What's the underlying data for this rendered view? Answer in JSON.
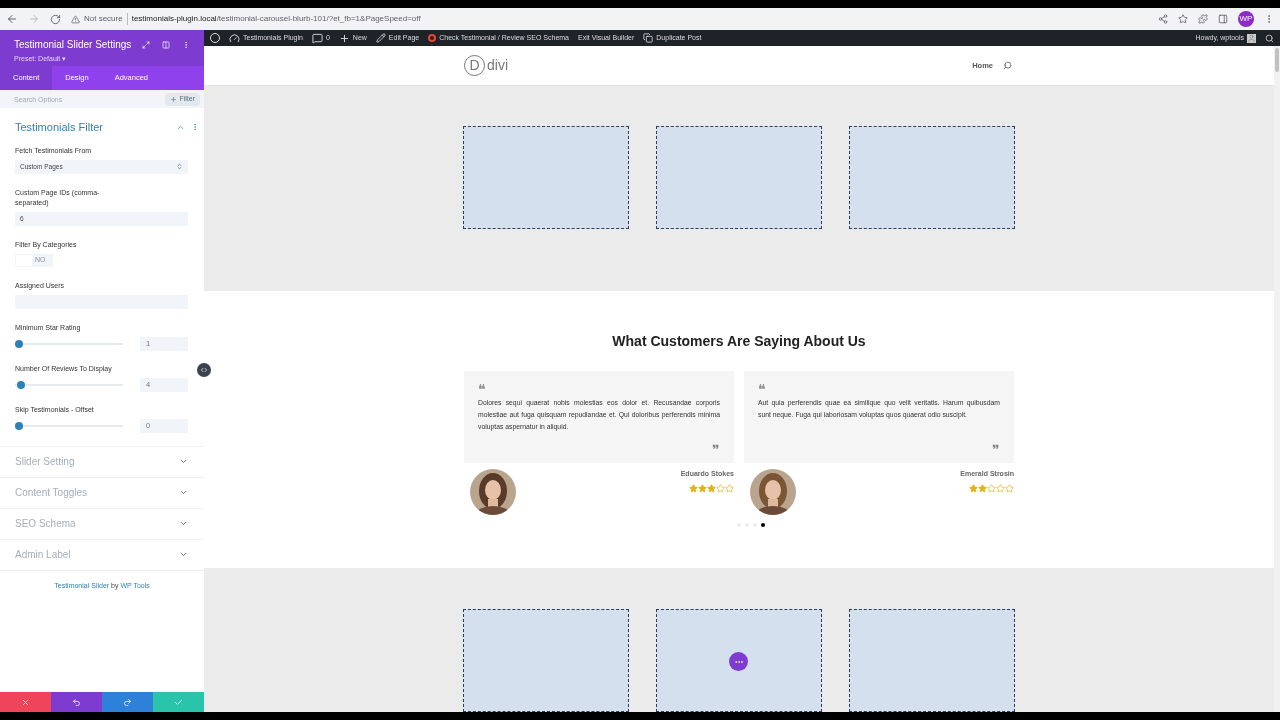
{
  "browser": {
    "security": "Not secure",
    "url_host": "testimonials-plugin.local",
    "url_path": "/testimonial-carousel-blurb-101/?et_fb=1&PageSpeed=off",
    "avatar": "WP"
  },
  "admin_bar": {
    "items": [
      {
        "kind": "site",
        "label": "Testimonials Plugin"
      },
      {
        "kind": "comments",
        "label": "0"
      },
      {
        "kind": "new",
        "label": "New"
      },
      {
        "kind": "edit",
        "label": "Edit Page"
      },
      {
        "kind": "google",
        "label": "Check Testimonial / Review SEO Schema"
      },
      {
        "kind": "plain",
        "label": "Exit Visual Builder"
      },
      {
        "kind": "duplicate",
        "label": "Duplicate Post"
      }
    ],
    "greeting": "Howdy, wptools"
  },
  "panel": {
    "title": "Testimonial Slider Settings",
    "preset": "Preset: Default ▾",
    "tabs": [
      {
        "label": "Content",
        "selected": true
      },
      {
        "label": "Design",
        "selected": false
      },
      {
        "label": "Advanced",
        "selected": false
      }
    ],
    "search": {
      "placeholder": "Search Options"
    },
    "filter_button": "Filter",
    "open_group": {
      "title": "Testimonials Filter",
      "expanded": true,
      "fields": [
        {
          "kind": "select",
          "label": "Fetch Testimonials From",
          "value": "Custom Pages"
        },
        {
          "kind": "text",
          "label": "Custom Page IDs (comma-separated)",
          "value": "6"
        },
        {
          "kind": "toggle",
          "label": "Filter By Categories",
          "on": false,
          "state_label": "NO"
        },
        {
          "kind": "text",
          "label": "Assigned Users"
        },
        {
          "kind": "slider",
          "label": "Minimum Star Rating",
          "level": 0,
          "value": "1"
        },
        {
          "kind": "slider",
          "label": "Number Of Reviews To Display",
          "level": 0.02,
          "value": "4"
        },
        {
          "kind": "slider",
          "label": "Skip Testimonials - Offset",
          "level": 0,
          "value": "0"
        }
      ]
    },
    "groups": [
      {
        "title": "Slider Setting",
        "expanded": false
      },
      {
        "title": "Content Toggles",
        "expanded": false
      },
      {
        "title": "SEO Schema",
        "expanded": false
      },
      {
        "title": "Admin Label",
        "expanded": false
      }
    ],
    "credit": {
      "plugin": "Testimonial Slider",
      "by": "by",
      "author": "WP Tools"
    }
  },
  "site": {
    "logo_letter": "D",
    "logo_text": "divi",
    "nav": [
      "Home"
    ]
  },
  "heading": "What Customers Are Saying About Us",
  "testimonials": [
    {
      "text": "Dolores sequi quaerat nobis molestias eos dolor et. Recusandae corporis molestiae aut fuga quisquam repudiandae et. Qui doloribus perferendis minima voluptas aspernatur in aliquid.",
      "open_quote": "❝",
      "close_quote": "❞",
      "name": "Eduardo Stokes",
      "stars": 3
    },
    {
      "text": "Aut quia perferendis quae ea similique quo velit veritatis. Harum quibusdam sunt neque. Fuga qui laboriosam voluptas quos quaerat odio suscipit.",
      "open_quote": "❝",
      "close_quote": "❞",
      "name": "Emerald Strosin",
      "stars": 2
    }
  ],
  "carousel_dots": [
    {
      "selected": false
    },
    {
      "selected": false
    },
    {
      "selected": false
    },
    {
      "selected": true
    }
  ]
}
